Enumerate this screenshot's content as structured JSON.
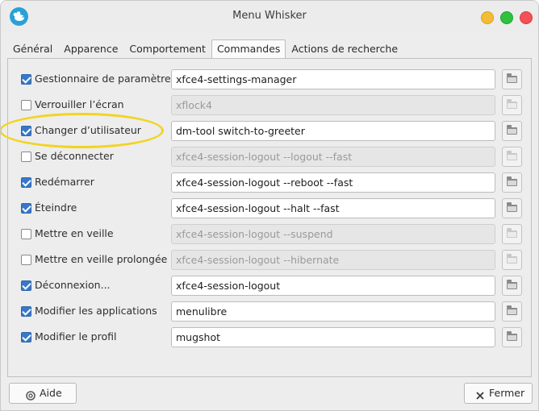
{
  "window": {
    "title": "Menu Whisker"
  },
  "tabs": [
    {
      "label": "Général",
      "active": false
    },
    {
      "label": "Apparence",
      "active": false
    },
    {
      "label": "Comportement",
      "active": false
    },
    {
      "label": "Commandes",
      "active": true
    },
    {
      "label": "Actions de recherche",
      "active": false
    }
  ],
  "commands": [
    {
      "label": "Gestionnaire de paramètres",
      "checked": true,
      "command": "xfce4-settings-manager"
    },
    {
      "label": "Verrouiller l’écran",
      "checked": false,
      "command": "xflock4"
    },
    {
      "label": "Changer d’utilisateur",
      "checked": true,
      "command": "dm-tool switch-to-greeter"
    },
    {
      "label": "Se déconnecter",
      "checked": false,
      "command": "xfce4-session-logout --logout --fast"
    },
    {
      "label": "Redémarrer",
      "checked": true,
      "command": "xfce4-session-logout --reboot --fast"
    },
    {
      "label": "Éteindre",
      "checked": true,
      "command": "xfce4-session-logout --halt --fast"
    },
    {
      "label": "Mettre en veille",
      "checked": false,
      "command": "xfce4-session-logout --suspend"
    },
    {
      "label": "Mettre en veille prolongée",
      "checked": false,
      "command": "xfce4-session-logout --hibernate"
    },
    {
      "label": "Déconnexion...",
      "checked": true,
      "command": "xfce4-session-logout"
    },
    {
      "label": "Modifier les applications",
      "checked": true,
      "command": "menulibre"
    },
    {
      "label": "Modifier le profil",
      "checked": true,
      "command": "mugshot"
    }
  ],
  "footer": {
    "help_label": "Aide",
    "close_label": "Fermer"
  },
  "icons": {
    "app": "mouse-logo-icon",
    "browse": "folder-icon",
    "help": "help-lifebuoy-icon",
    "close": "close-x-icon"
  },
  "colors": {
    "checkbox_checked": "#3778c7",
    "highlight_annotation": "#f2d420",
    "window_minimize": "#f3bc35",
    "window_maximize": "#2fc13f",
    "window_close": "#f25257"
  }
}
